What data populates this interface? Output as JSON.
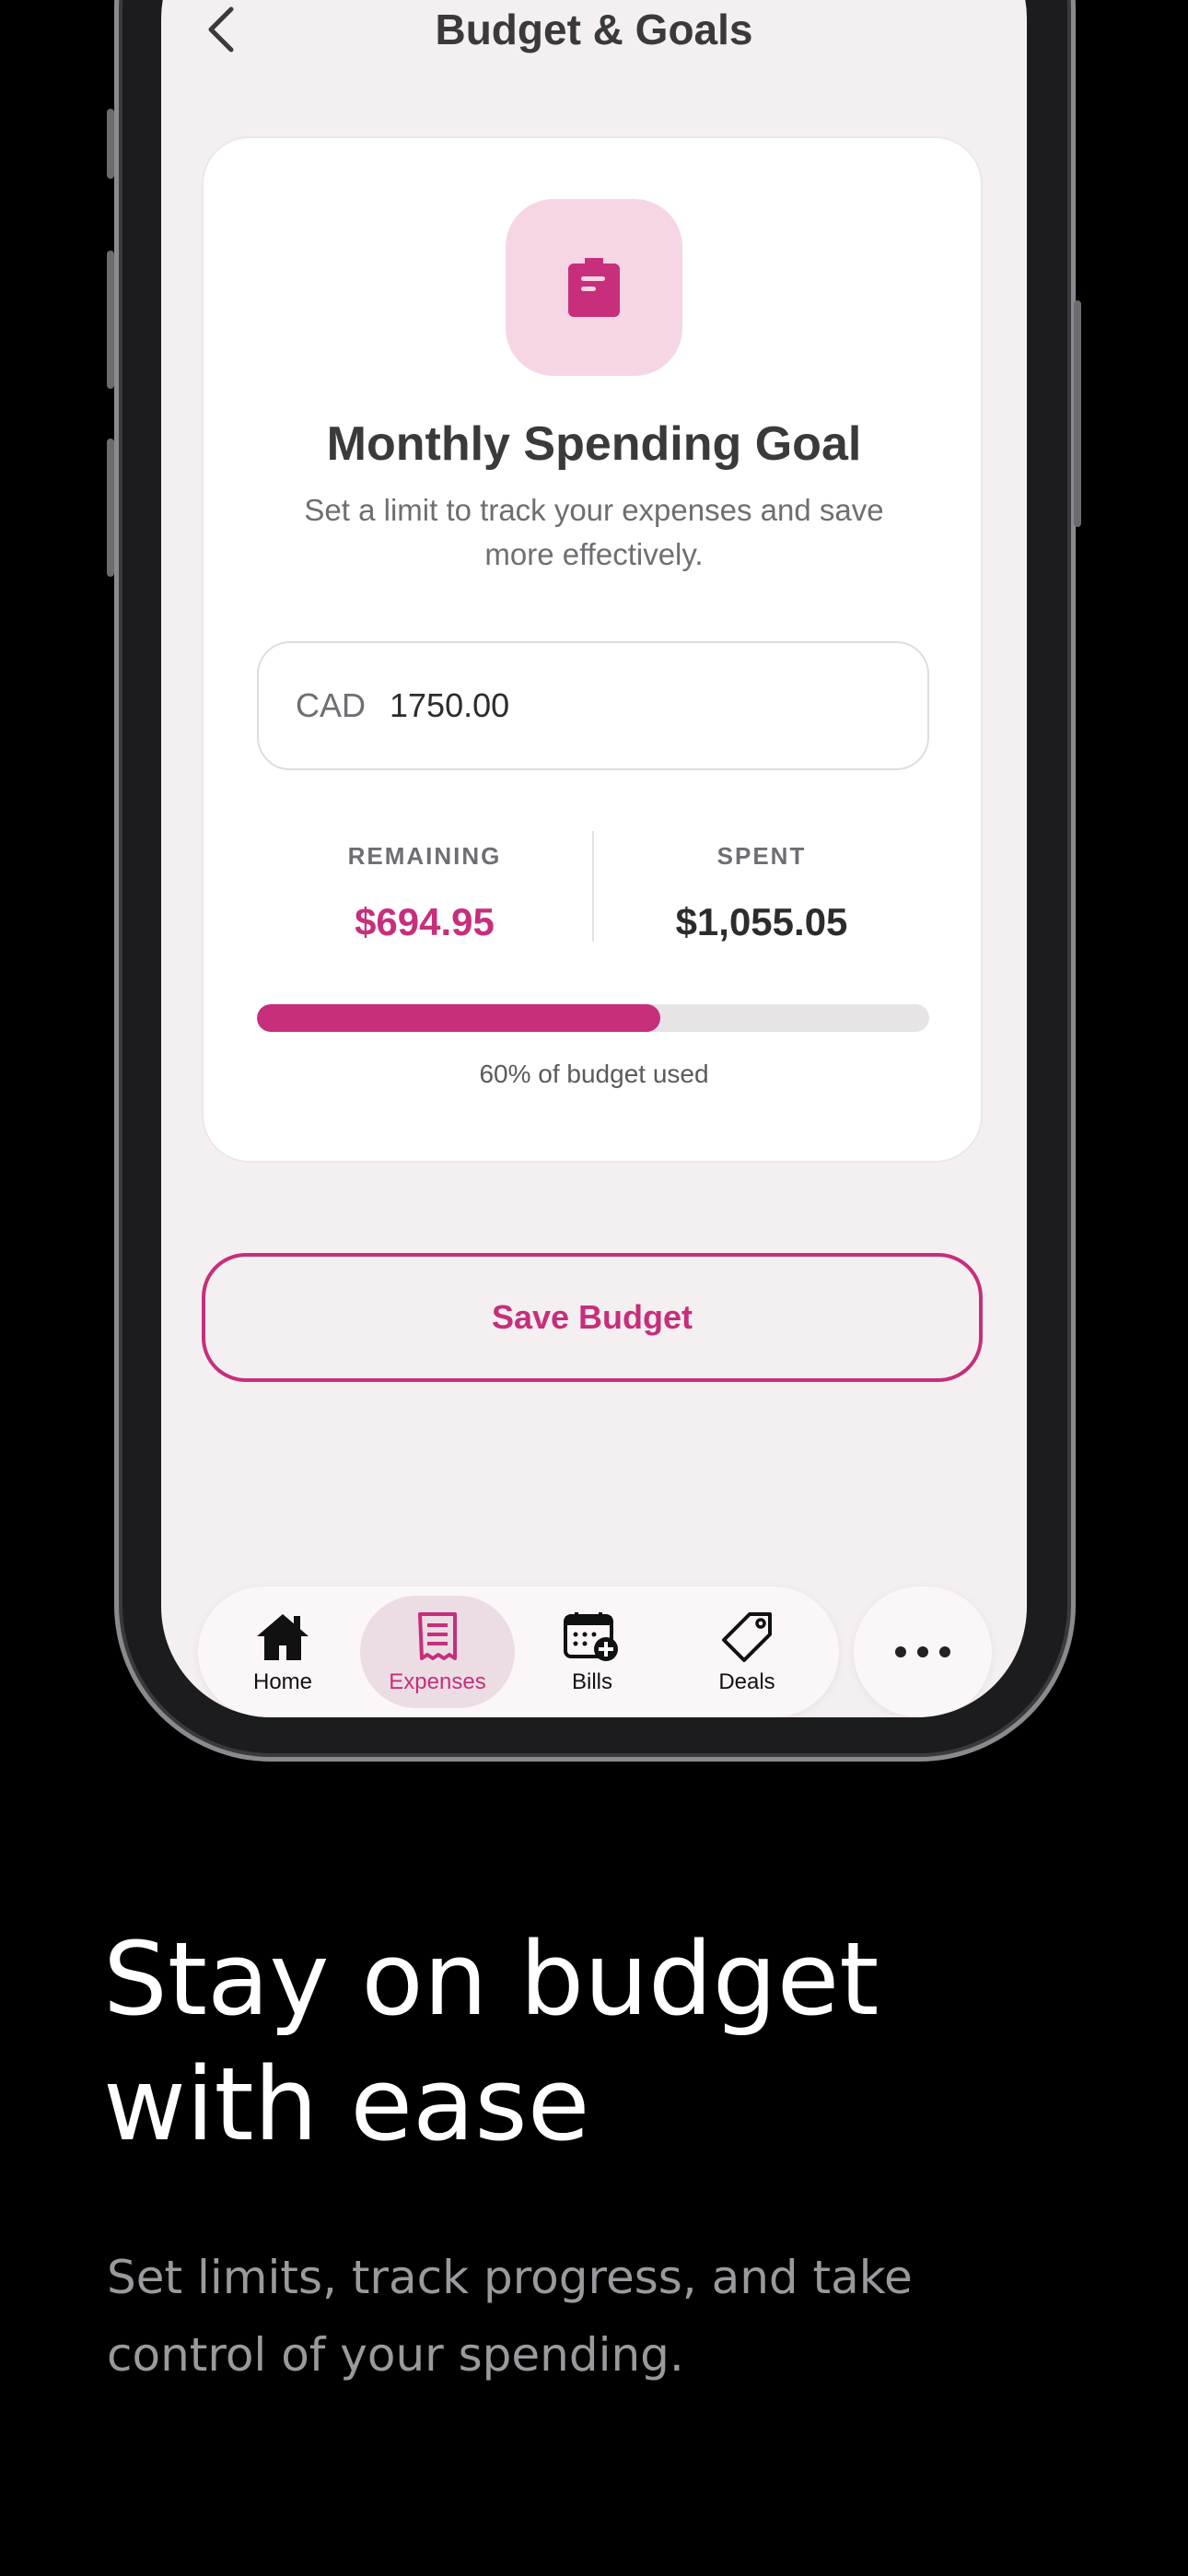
{
  "header": {
    "title": "Budget & Goals",
    "back_icon": "chevron-left-icon"
  },
  "card": {
    "icon": "clipboard-icon",
    "title": "Monthly Spending Goal",
    "description": "Set a limit to track your expenses and save more effectively.",
    "input": {
      "currency": "CAD",
      "value": "1750.00"
    },
    "stats": {
      "remaining_label": "REMAINING",
      "remaining_value": "$694.95",
      "spent_label": "SPENT",
      "spent_value": "$1,055.05"
    },
    "progress": {
      "fraction": 0.6,
      "text": "60% of budget used"
    }
  },
  "save_button": {
    "label": "Save Budget"
  },
  "tabbar": {
    "items": [
      {
        "label": "Home",
        "icon": "home-icon",
        "active": false
      },
      {
        "label": "Expenses",
        "icon": "receipt-icon",
        "active": true
      },
      {
        "label": "Bills",
        "icon": "calendar-add-icon",
        "active": false
      },
      {
        "label": "Deals",
        "icon": "tag-icon",
        "active": false
      }
    ],
    "more_icon": "more-icon"
  },
  "marketing": {
    "headline": "Stay on budget with ease",
    "subline": "Set limits, track progress, and take control of your spending."
  },
  "colors": {
    "accent": "#c72e7b",
    "background": "#f4eff1",
    "icon_bg": "#f6d6e5"
  }
}
